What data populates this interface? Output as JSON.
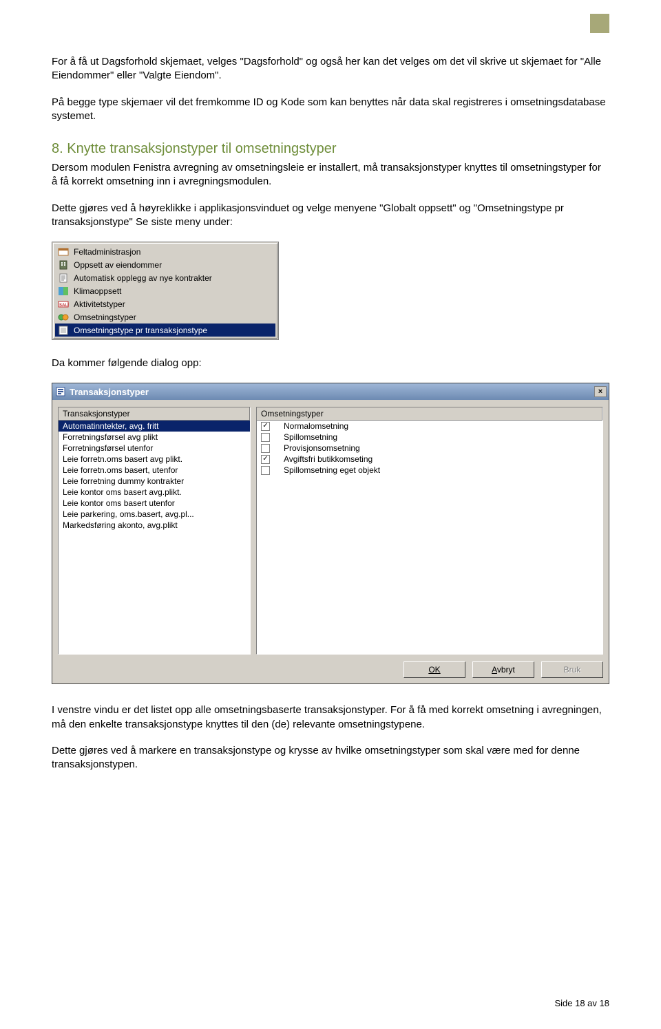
{
  "decor": {
    "topbox": true
  },
  "para1": "For å få ut Dagsforhold skjemaet, velges \"Dagsforhold\" og også her kan det velges om det vil skrive ut skjemaet for \"Alle Eiendommer\" eller \"Valgte Eiendom\".",
  "para2": "På begge type skjemaer vil det fremkomme ID og Kode som kan benyttes når data skal registreres i omsetningsdatabase systemet.",
  "heading8": "8.  Knytte transaksjonstyper til omsetningstyper",
  "para3": "Dersom modulen Fenistra avregning av omsetningsleie er installert, må transaksjonstyper knyttes til omsetningstyper for å få korrekt omsetning inn i avregningsmodulen.",
  "para4": "Dette gjøres ved å høyreklikke i applikasjonsvinduet og velge menyene \"Globalt oppsett\" og \"Omsetningstype pr transaksjonstype\" Se siste meny under:",
  "menu": {
    "items": [
      {
        "label": "Feltadministrasjon",
        "icon": "card-icon"
      },
      {
        "label": "Oppsett av eiendommer",
        "icon": "building-icon"
      },
      {
        "label": "Automatisk opplegg av nye kontrakter",
        "icon": "doc-icon"
      },
      {
        "label": "Klimaoppsett",
        "icon": "klima-icon"
      },
      {
        "label": "Aktivitetstyper",
        "icon": "sale-icon"
      },
      {
        "label": "Omsetningstyper",
        "icon": "tag-icon"
      },
      {
        "label": "Omsetningstype pr transaksjonstype",
        "icon": "sheet-icon",
        "selected": true
      }
    ]
  },
  "para5": "Da kommer følgende dialog opp:",
  "dialog": {
    "title": "Transaksjonstyper",
    "close": "×",
    "left_header": "Transaksjonstyper",
    "right_header": "Omsetningstyper",
    "left_items": [
      {
        "label": "Automatinntekter, avg. fritt",
        "selected": true
      },
      {
        "label": "Forretningsførsel avg plikt"
      },
      {
        "label": "Forretningsførsel utenfor"
      },
      {
        "label": "Leie forretn.oms basert avg plikt."
      },
      {
        "label": "Leie forretn.oms basert, utenfor"
      },
      {
        "label": "Leie forretning dummy kontrakter"
      },
      {
        "label": "Leie kontor oms basert avg.plikt."
      },
      {
        "label": "Leie kontor oms basert utenfor"
      },
      {
        "label": "Leie parkering, oms.basert, avg.pl..."
      },
      {
        "label": "Markedsføring akonto, avg.plikt"
      }
    ],
    "right_items": [
      {
        "label": "Normalomsetning",
        "checked": true
      },
      {
        "label": "Spillomsetning",
        "checked": false
      },
      {
        "label": "Provisjonsomsetning",
        "checked": false
      },
      {
        "label": "Avgiftsfri butikkomseting",
        "checked": true
      },
      {
        "label": "Spillomsetning eget objekt",
        "checked": false
      }
    ],
    "buttons": {
      "ok": "OK",
      "cancel": "Avbryt",
      "apply": "Bruk"
    }
  },
  "para6": "I venstre vindu er det listet opp alle omsetningsbaserte transaksjonstyper. For å få med korrekt omsetning i avregningen, må den enkelte transaksjonstype knyttes til den (de) relevante omsetningstypene.",
  "para7": "Dette gjøres ved å markere en transaksjonstype og krysse av hvilke omsetningstyper som skal være med for denne transaksjonstypen.",
  "footer": "Side 18 av 18"
}
